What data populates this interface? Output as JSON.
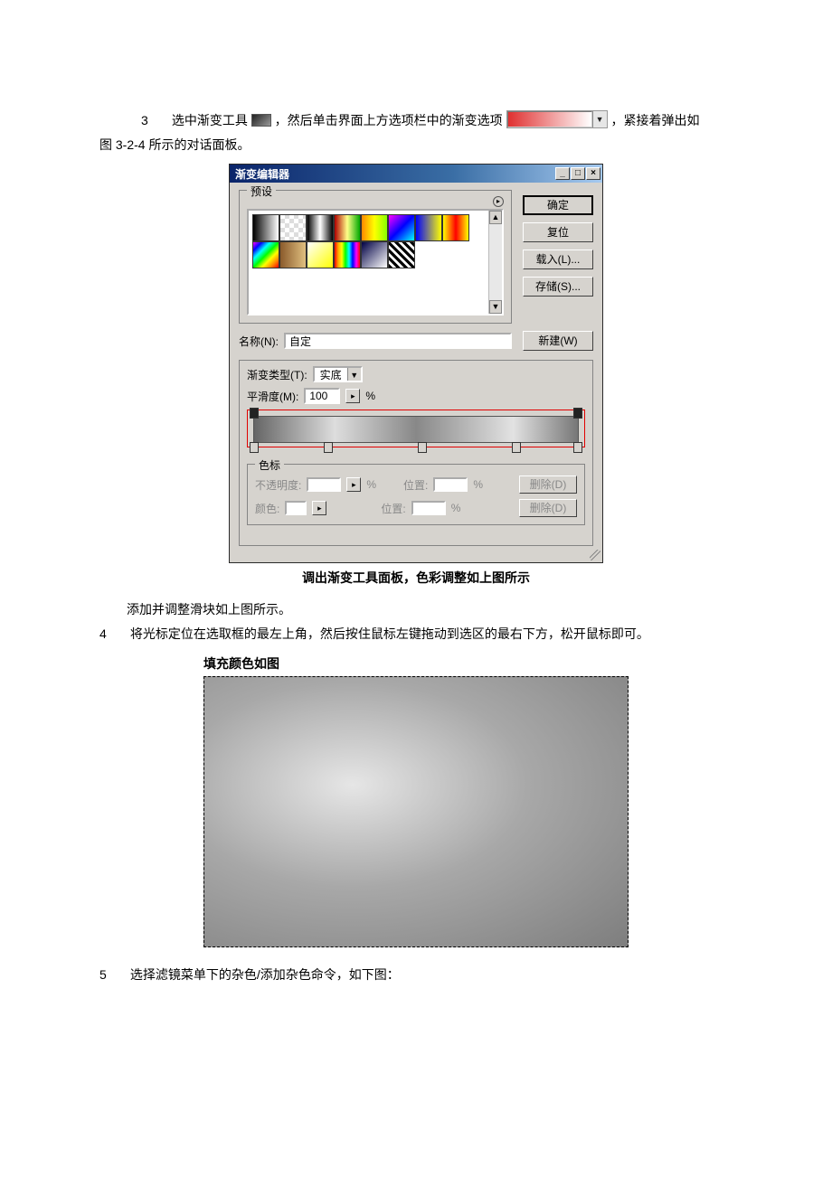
{
  "step3": {
    "num": "3",
    "before_icon": "选中渐变工具",
    "after_icon": "，然后单击界面上方选项栏中的渐变选项",
    "after_swatch": "，紧接着弹出如",
    "line2": "图 3-2-4 所示的对话面板。"
  },
  "dialog": {
    "title": "渐变编辑器",
    "presets_label": "预设",
    "buttons": {
      "ok": "确定",
      "reset": "复位",
      "load": "载入(L)...",
      "save": "存储(S)..."
    },
    "name_label": "名称(N):",
    "name_value": "自定",
    "new_btn": "新建(W)",
    "type_label": "渐变类型(T):",
    "type_value": "实底",
    "smooth_label": "平滑度(M):",
    "smooth_value": "100",
    "smooth_unit": "%",
    "stops_label": "色标",
    "opacity_label": "不透明度:",
    "position_label": "位置:",
    "percent": "%",
    "color_label": "颜色:",
    "delete_label": "删除(D)"
  },
  "caption1": "调出渐变工具面板，色彩调整如上图所示",
  "after_caption": "添加并调整滑块如上图所示。",
  "step4": {
    "num": "4",
    "text": "将光标定位在选取框的最左上角，然后按住鼠标左键拖动到选区的最右下方，松开鼠标即可。"
  },
  "fill_title": "填充颜色如图",
  "step5": {
    "num": "5",
    "text": "选择滤镜菜单下的杂色/添加杂色命令，如下图："
  },
  "preset_gradients": [
    "linear-gradient(90deg,#000,#fff)",
    "repeating-conic-gradient(#ddd 0 25%,#fff 0 50%) 0/10px 10px",
    "linear-gradient(90deg,#000,#fff,#000)",
    "linear-gradient(90deg,#b00000,#ff8,#0a0)",
    "linear-gradient(90deg,#f80,#ff0,#8f0)",
    "linear-gradient(135deg,#f0f,#00f,#0ff)",
    "linear-gradient(90deg,#00f,#ff0)",
    "linear-gradient(90deg,#ff0,#f00,#ff0)",
    "linear-gradient(135deg,#f0f,#00f,#0ff,#0f0,#ff0,#f80,#f00)",
    "linear-gradient(90deg,#8a5a2b,#e0c080)",
    "linear-gradient(135deg,#fff,#ff0)",
    "linear-gradient(90deg,red,orange,yellow,lime,cyan,blue,magenta,red)",
    "linear-gradient(135deg,#004,#fff)",
    "repeating-linear-gradient(45deg,#000 0 3px,#fff 3px 6px)"
  ]
}
